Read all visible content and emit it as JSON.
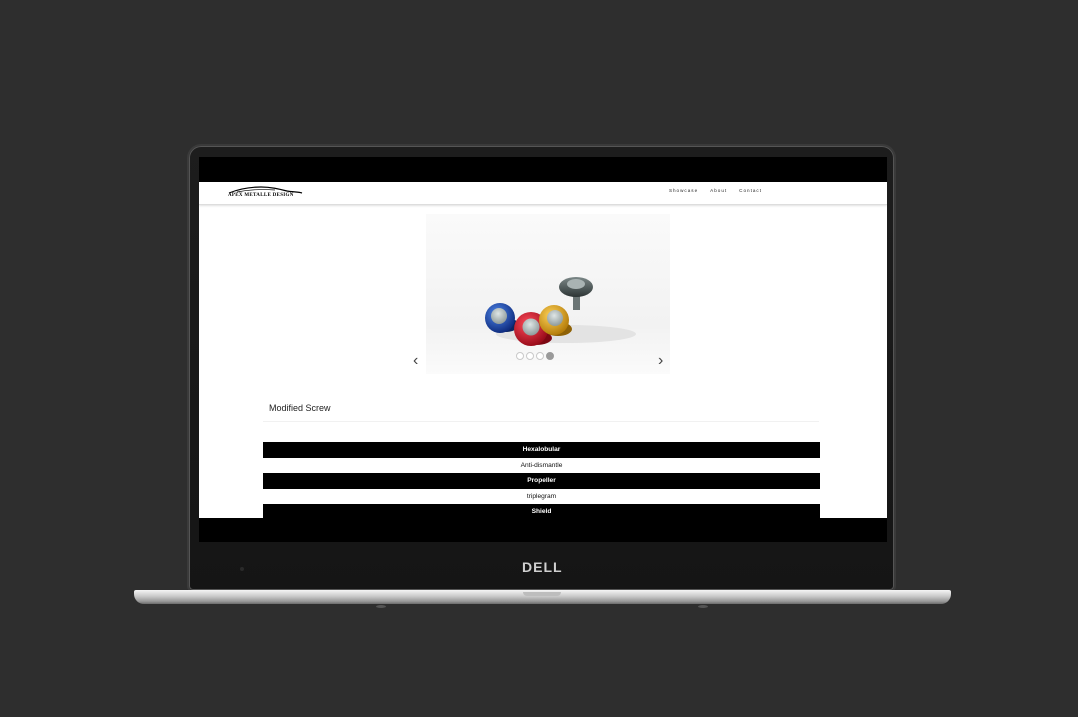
{
  "brand": {
    "logo_text": "APEX METALLE DESIGN",
    "laptop_logo": "DELL"
  },
  "nav": {
    "items": [
      {
        "label": "Showcase"
      },
      {
        "label": "About"
      },
      {
        "label": "Contact"
      }
    ]
  },
  "carousel": {
    "prev_icon": "‹",
    "next_icon": "›",
    "slide_count": 4,
    "active_index": 3
  },
  "section": {
    "title": "Modified Screw"
  },
  "menu": {
    "items": [
      {
        "label": "Hexalobular",
        "style": "dark"
      },
      {
        "label": "Anti-dismantle",
        "style": "light"
      },
      {
        "label": "Propeller",
        "style": "dark"
      },
      {
        "label": "triplegram",
        "style": "light"
      },
      {
        "label": "Shield",
        "style": "dark"
      }
    ]
  },
  "colors": {
    "background": "#2e2e2e",
    "screw_blue": "#1f4fb0",
    "screw_red": "#d8192d",
    "screw_gold": "#e0a91b",
    "screw_gray": "#4d5a5a"
  }
}
